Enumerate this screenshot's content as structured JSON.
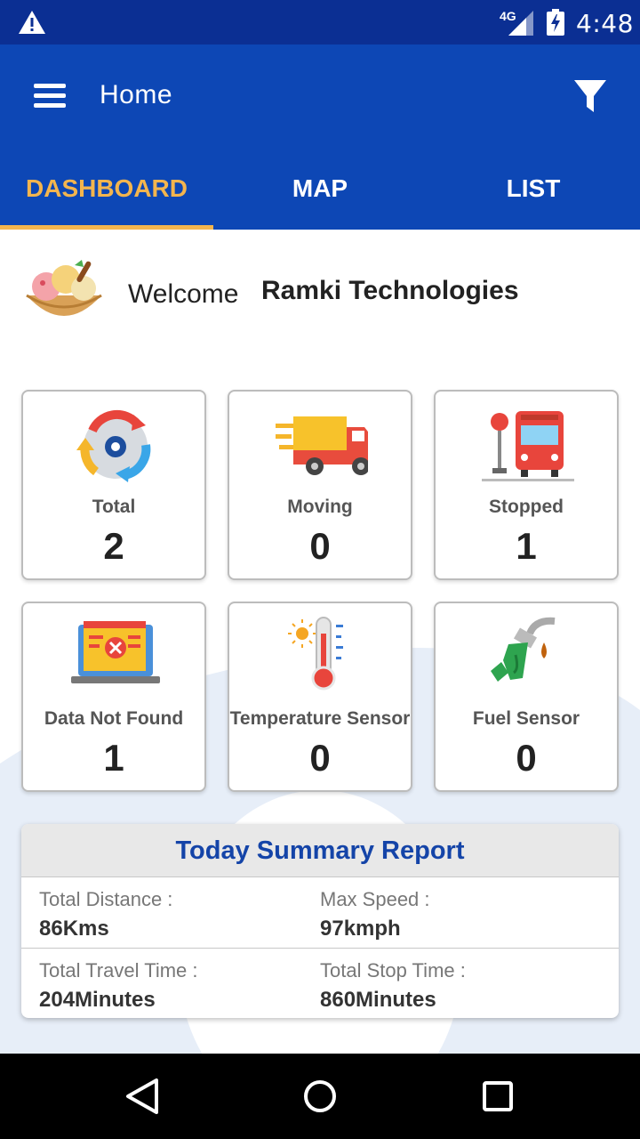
{
  "status_bar": {
    "network": "4G",
    "time": "4:48",
    "icons": [
      "warning-icon",
      "signal-icon",
      "battery-charging-icon"
    ]
  },
  "app_bar": {
    "title": "Home",
    "icons": [
      "menu-icon",
      "filter-icon"
    ]
  },
  "tabs": [
    {
      "label": "DASHBOARD",
      "active": true
    },
    {
      "label": "MAP",
      "active": false
    },
    {
      "label": "LIST",
      "active": false
    }
  ],
  "welcome": {
    "greeting": "Welcome",
    "name": "Ramki Technologies"
  },
  "cards": [
    {
      "label": "Total",
      "value": "2",
      "icon": "total-vehicles-icon"
    },
    {
      "label": "Moving",
      "value": "0",
      "icon": "truck-icon"
    },
    {
      "label": "Stopped",
      "value": "1",
      "icon": "bus-stop-icon"
    },
    {
      "label": "Data Not Found",
      "value": "1",
      "icon": "laptop-error-icon"
    },
    {
      "label": "Temperature Sensor",
      "value": "0",
      "icon": "thermometer-icon"
    },
    {
      "label": "Fuel Sensor",
      "value": "0",
      "icon": "fuel-nozzle-icon"
    }
  ],
  "summary": {
    "title": "Today Summary Report",
    "items": [
      {
        "label": "Total Distance :",
        "value": "86Kms"
      },
      {
        "label": "Max Speed :",
        "value": "97kmph"
      },
      {
        "label": "Total Travel Time :",
        "value": "204Minutes"
      },
      {
        "label": "Total Stop Time :",
        "value": "860Minutes"
      }
    ]
  },
  "colors": {
    "primary": "#0d47b5",
    "status_bar": "#0b2f93",
    "accent": "#f3b54e",
    "summary_title": "#1444a8"
  }
}
